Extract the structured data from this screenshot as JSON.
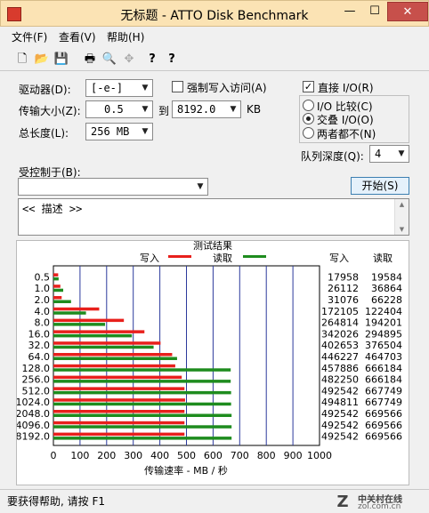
{
  "window": {
    "title": "无标题 - ATTO Disk Benchmark",
    "min_glyph": "—",
    "max_glyph": "☐",
    "close_glyph": "✕"
  },
  "menu": [
    "文件(F)",
    "查看(V)",
    "帮助(H)"
  ],
  "toolbar": {
    "icons": [
      "new-file-icon",
      "open-folder-icon",
      "save-icon",
      "print-icon",
      "print-preview-icon",
      "move-icon",
      "help-icon",
      "context-help-icon"
    ],
    "glyphs": [
      "🗋",
      "📂",
      "💾",
      "🖶",
      "🔍",
      "✥",
      "?",
      "?"
    ]
  },
  "settings": {
    "drive_label": "驱动器(D):",
    "drive_value": "[-e-]",
    "force_write_label": "强制写入访问(A)",
    "transfer_label": "传输大小(Z):",
    "transfer_from": "0.5",
    "transfer_to_label": "到",
    "transfer_to": "8192.0",
    "transfer_unit": "KB",
    "total_label": "总长度(L):",
    "total_value": "256 MB",
    "direct_io_label": "直接 I/O(R)",
    "io_compare_label": "I/O 比较(C)",
    "overlapped_label": "交叠 I/O(O)",
    "neither_label": "两者都不(N)",
    "queue_label": "队列深度(Q):",
    "queue_value": "4",
    "controlled_label": "受控制于(B):",
    "controlled_value": "",
    "start_label": "开始(S)",
    "description": "<< 描述 >>",
    "arrow": "▼",
    "check": "✓"
  },
  "results": {
    "header": "测试结果",
    "legend_write": "写入",
    "legend_read": "读取",
    "col_write": "写入",
    "col_read": "读取",
    "xlabel": "传输速率 - MB / 秒"
  },
  "chart_data": {
    "type": "bar",
    "orientation": "horizontal",
    "categories": [
      "0.5",
      "1.0",
      "2.0",
      "4.0",
      "8.0",
      "16.0",
      "32.0",
      "64.0",
      "128.0",
      "256.0",
      "512.0",
      "1024.0",
      "2048.0",
      "4096.0",
      "8192.0"
    ],
    "series": [
      {
        "name": "写入",
        "color": "#e8201c",
        "values": [
          17958,
          26112,
          31076,
          172105,
          264814,
          342026,
          402653,
          446227,
          457886,
          482250,
          492542,
          494811,
          492542,
          492542,
          492542
        ]
      },
      {
        "name": "读取",
        "color": "#1e8c1e",
        "values": [
          19584,
          36864,
          66228,
          122404,
          194201,
          294895,
          376504,
          464703,
          666184,
          666184,
          667749,
          667749,
          669566,
          669566,
          669566
        ]
      }
    ],
    "xlim": [
      0,
      1000
    ],
    "xticks": [
      0,
      100,
      200,
      300,
      400,
      500,
      600,
      700,
      800,
      900,
      1000
    ],
    "grid": true,
    "legend_placement": "top"
  },
  "status": {
    "text": "要获得帮助, 请按 F1"
  },
  "watermark": {
    "logo": "Z",
    "title": "中关村在线",
    "url": "zol.com.cn"
  }
}
